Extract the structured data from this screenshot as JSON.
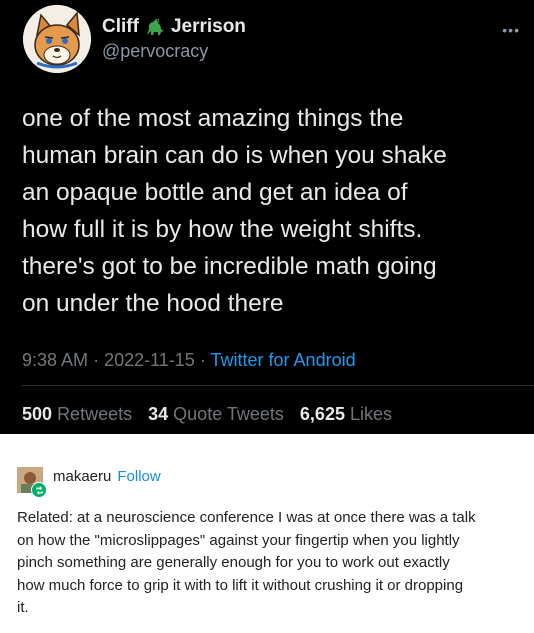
{
  "tweet": {
    "display_name_first": "Cliff",
    "display_name_last": "Jerrison",
    "name_emoji_icon": "dinosaur-icon",
    "handle": "@pervocracy",
    "more_icon": "more-options-icon",
    "lines": [
      "one of the most amazing things the",
      "human brain can do is when you shake",
      "an opaque bottle and get an idea of",
      "how full it is by how the weight shifts.",
      "there's got to be incredible math going",
      "on under the hood there"
    ],
    "time": "9:38 AM",
    "separator": "·",
    "date": "2022-11-15",
    "source": "Twitter for Android",
    "retweets_count": "500",
    "retweets_label": "Retweets",
    "quotes_count": "34",
    "quotes_label": "Quote Tweets",
    "likes_count": "6,625",
    "likes_label": "Likes"
  },
  "reblog": {
    "username": "makaeru",
    "follow_label": "Follow",
    "badge_icon": "reblog-icon",
    "lines": [
      "Related: at a neuroscience conference I was at once there was a talk",
      "on how the \"microslippages\" against your fingertip when you lightly",
      "pinch something are generally enough for you to work out exactly",
      "how much force to grip it with to lift it without crushing it or dropping",
      "it."
    ]
  },
  "colors": {
    "tweet_background": "#000000",
    "tweet_text": "#e7e9ea",
    "muted_text": "#71767b",
    "link_blue": "#1d9bf0",
    "tumblr_follow_blue": "#1a8fd6",
    "reblog_badge_green": "#00b16a"
  }
}
